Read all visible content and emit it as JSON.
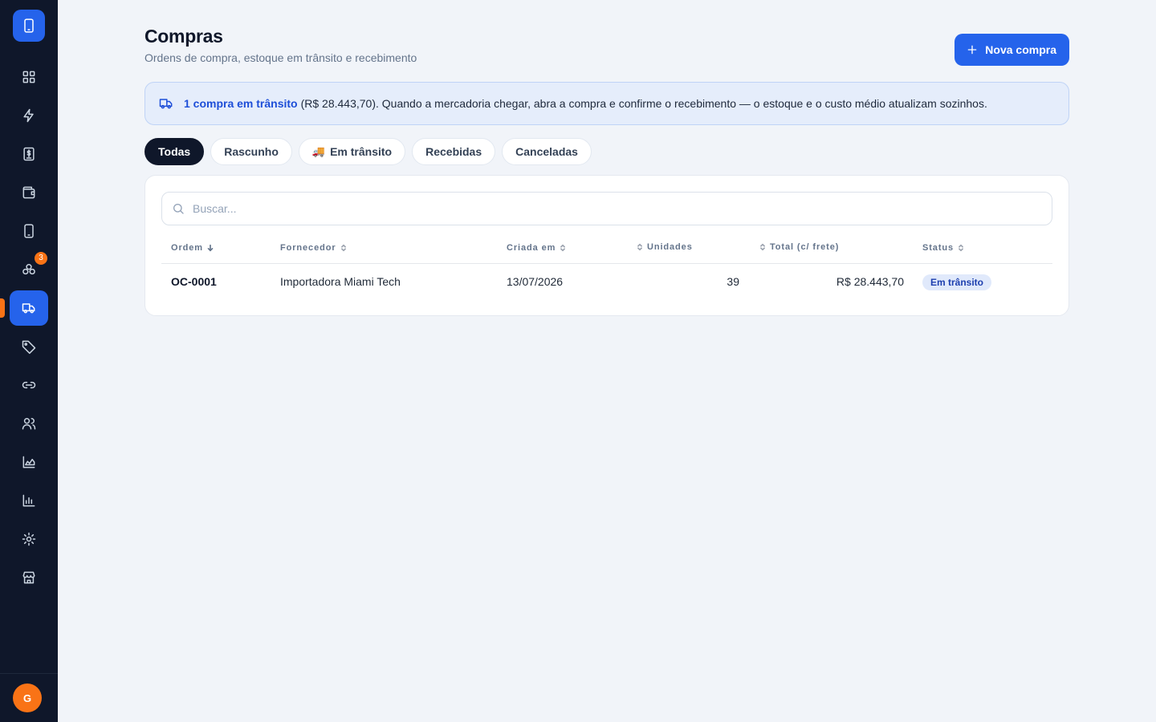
{
  "sidebar": {
    "items": [
      {
        "name": "dashboard",
        "icon": "grid-icon"
      },
      {
        "name": "quick",
        "icon": "bolt-icon"
      },
      {
        "name": "finance",
        "icon": "receipt-dollar-icon"
      },
      {
        "name": "wallet",
        "icon": "wallet-icon"
      },
      {
        "name": "devices",
        "icon": "smartphone-icon"
      },
      {
        "name": "parts",
        "icon": "boxes-icon",
        "badge": "3"
      },
      {
        "name": "purchases",
        "icon": "truck-icon",
        "active": true
      },
      {
        "name": "tags",
        "icon": "tag-icon"
      },
      {
        "name": "links",
        "icon": "link-icon"
      },
      {
        "name": "customers",
        "icon": "users-icon"
      },
      {
        "name": "charts",
        "icon": "area-chart-icon"
      },
      {
        "name": "reports",
        "icon": "bar-chart-icon"
      },
      {
        "name": "settings",
        "icon": "gear-icon"
      },
      {
        "name": "store",
        "icon": "store-icon"
      }
    ],
    "avatar_initial": "G",
    "accent_color": "#2563eb",
    "marker_color": "#f97316"
  },
  "header": {
    "title": "Compras",
    "subtitle": "Ordens de compra, estoque em trânsito e recebimento",
    "new_button": "Nova compra"
  },
  "banner": {
    "strong": "1 compra em trânsito",
    "text": "(R$ 28.443,70). Quando a mercadoria chegar, abra a compra e confirme o recebimento — o estoque e o custo médio atualizam sozinhos."
  },
  "tabs": [
    {
      "label": "Todas",
      "active": true
    },
    {
      "label": "Rascunho"
    },
    {
      "label": "Em trânsito",
      "emoji": "🚚"
    },
    {
      "label": "Recebidas"
    },
    {
      "label": "Canceladas"
    }
  ],
  "search": {
    "placeholder": "Buscar..."
  },
  "table": {
    "columns": [
      "Ordem",
      "Fornecedor",
      "Criada em",
      "Unidades",
      "Total (c/ frete)",
      "Status"
    ],
    "rows": [
      {
        "ordem": "OC-0001",
        "fornecedor": "Importadora Miami Tech",
        "criada_em": "13/07/2026",
        "unidades": "39",
        "total": "R$ 28.443,70",
        "status": "Em trânsito"
      }
    ]
  }
}
